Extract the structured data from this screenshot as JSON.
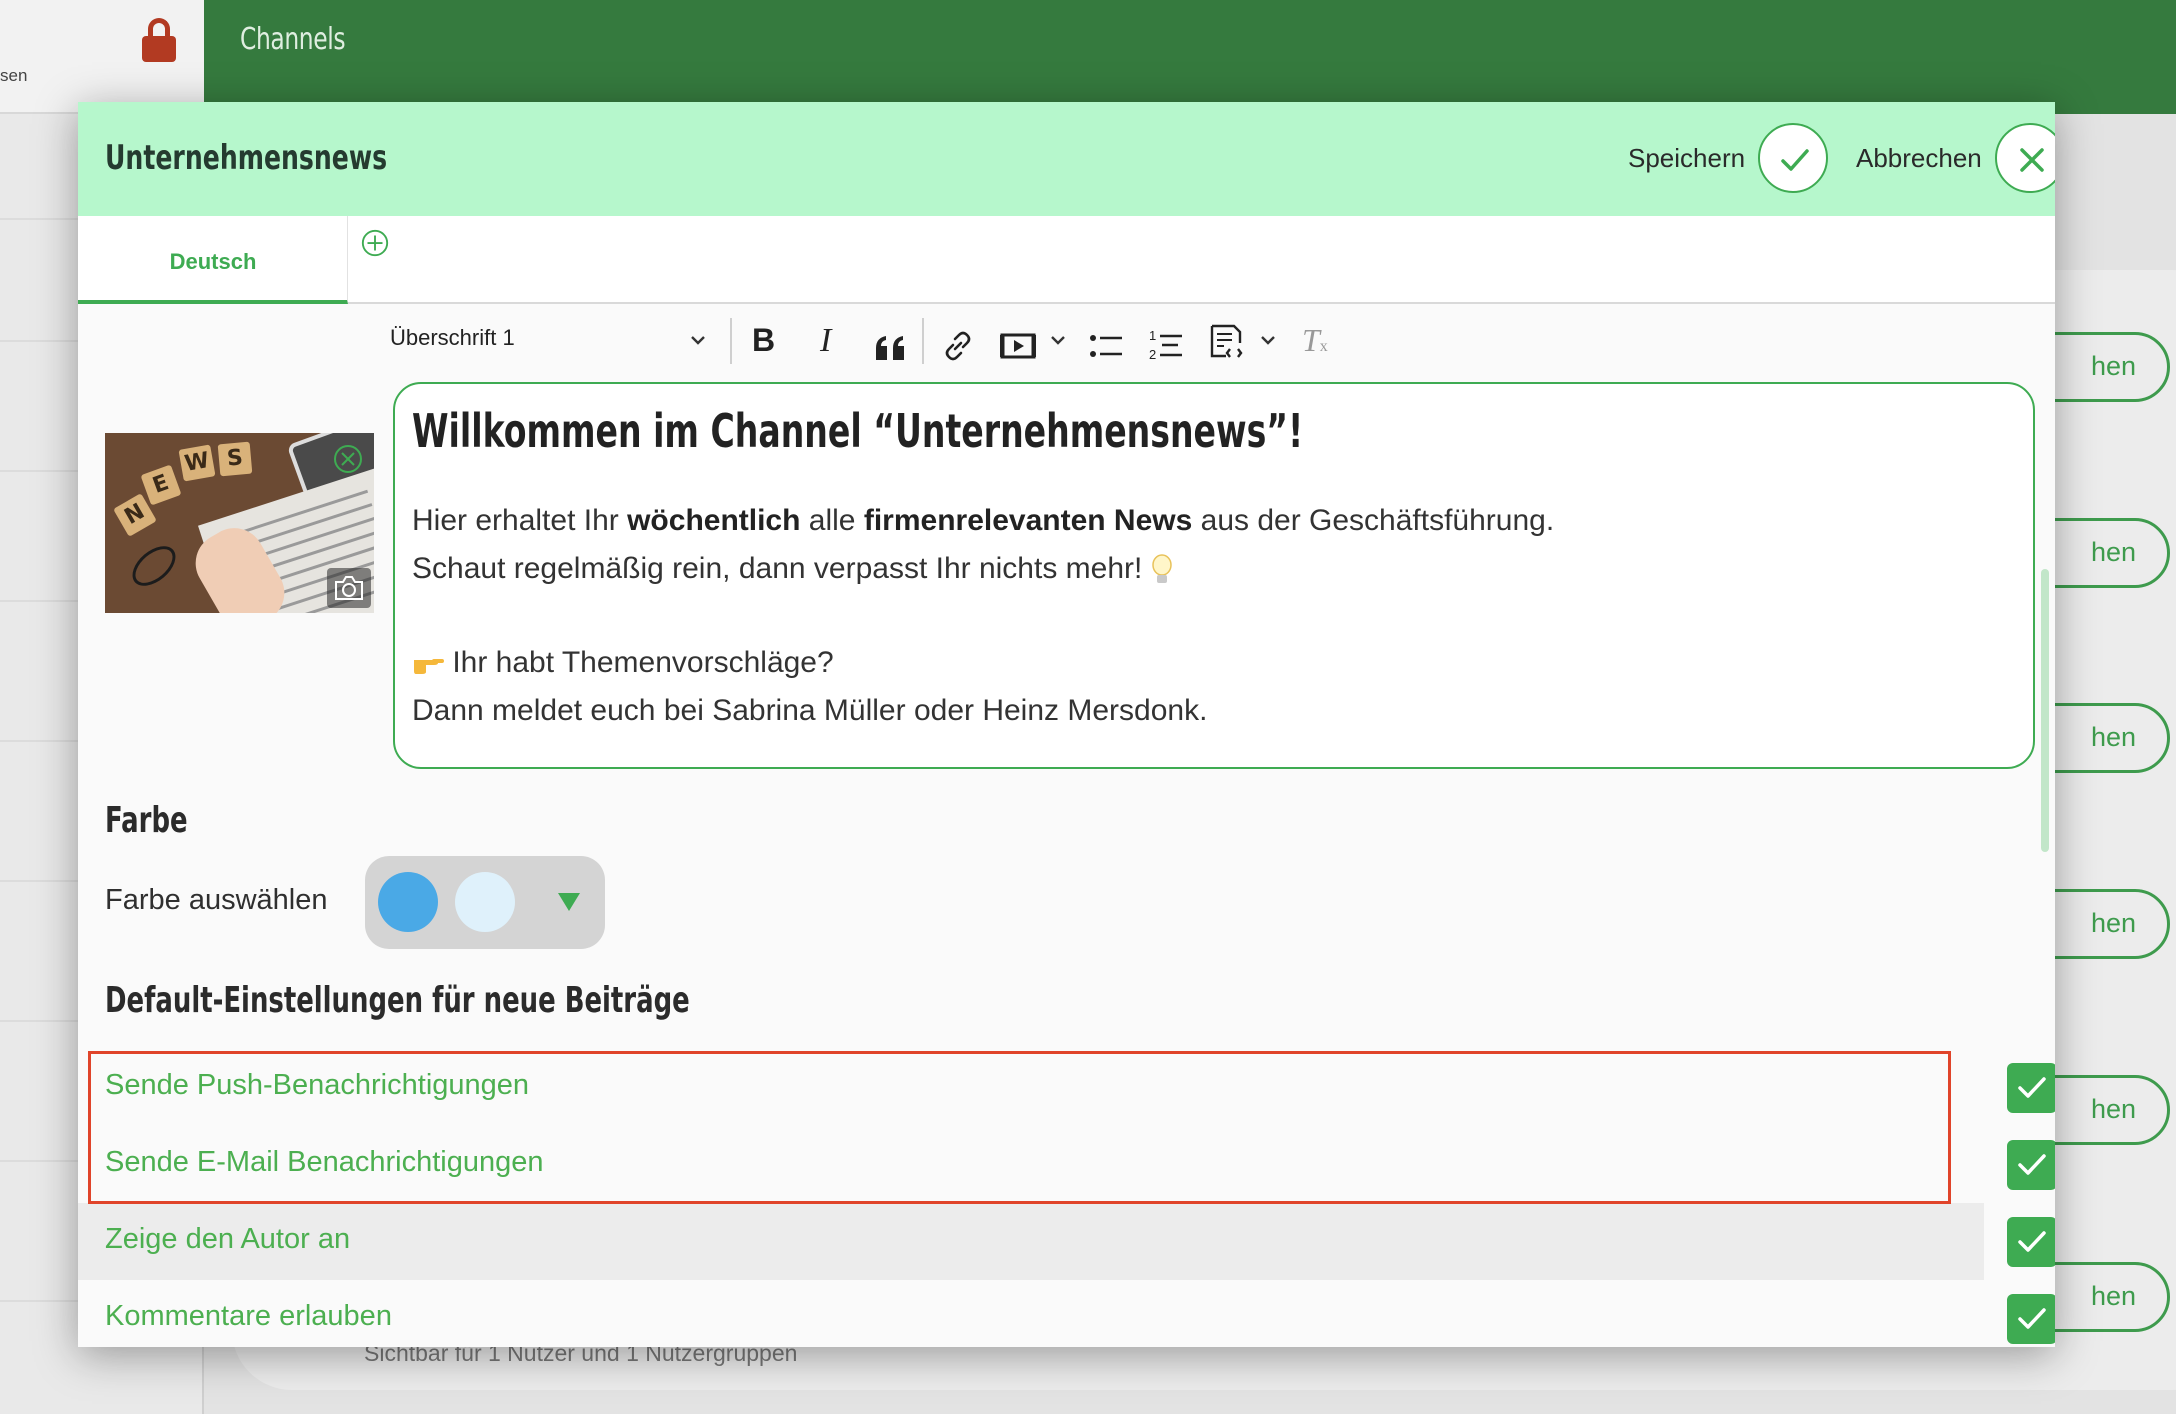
{
  "background": {
    "sidebar_partial_text": "sen",
    "top_title": "Channels",
    "pill_partial_text": "hen",
    "footer_text": "Sichtbar für 1 Nutzer und 1 Nutzergruppen"
  },
  "modal": {
    "title": "Unternehmensnews",
    "save_label": "Speichern",
    "cancel_label": "Abbrechen",
    "tabs": [
      {
        "label": "Deutsch",
        "active": true
      }
    ],
    "toolbar": {
      "heading_select": "Überschrift 1"
    },
    "editor": {
      "heading": "Willkommen im Channel “Unternehmensnews”!",
      "line1_a": "Hier erhaltet Ihr ",
      "line1_b": "wöchentlich",
      "line1_c": " alle ",
      "line1_d": "firmenrelevanten News",
      "line1_e": " aus der Geschäftsführung.",
      "line2": "Schaut regelmäßig rein, dann verpasst Ihr nichts mehr! ",
      "line3": " Ihr habt Themenvorschläge?",
      "line4": "Dann meldet euch bei Sabrina Müller oder Heinz Mersdonk."
    },
    "thumbnail_tiles": [
      "N",
      "E",
      "W",
      "S"
    ],
    "color_section": {
      "title": "Farbe",
      "label": "Farbe auswählen",
      "primary_color": "#4aa9e6",
      "secondary_color": "#dff1fb"
    },
    "defaults_section": {
      "title": "Default-Einstellungen für neue Beiträge",
      "options": [
        {
          "label": "Sende Push-Benachrichtigungen",
          "checked": true
        },
        {
          "label": "Sende E-Mail Benachrichtigungen",
          "checked": true
        },
        {
          "label": "Zeige den Autor an",
          "checked": true
        },
        {
          "label": "Kommentare erlauben",
          "checked": true
        }
      ]
    }
  },
  "colors": {
    "accent_green": "#3eab52",
    "header_mint": "#b6f7cc",
    "topbar_green": "#357a3e",
    "highlight_red": "#e0442a"
  }
}
